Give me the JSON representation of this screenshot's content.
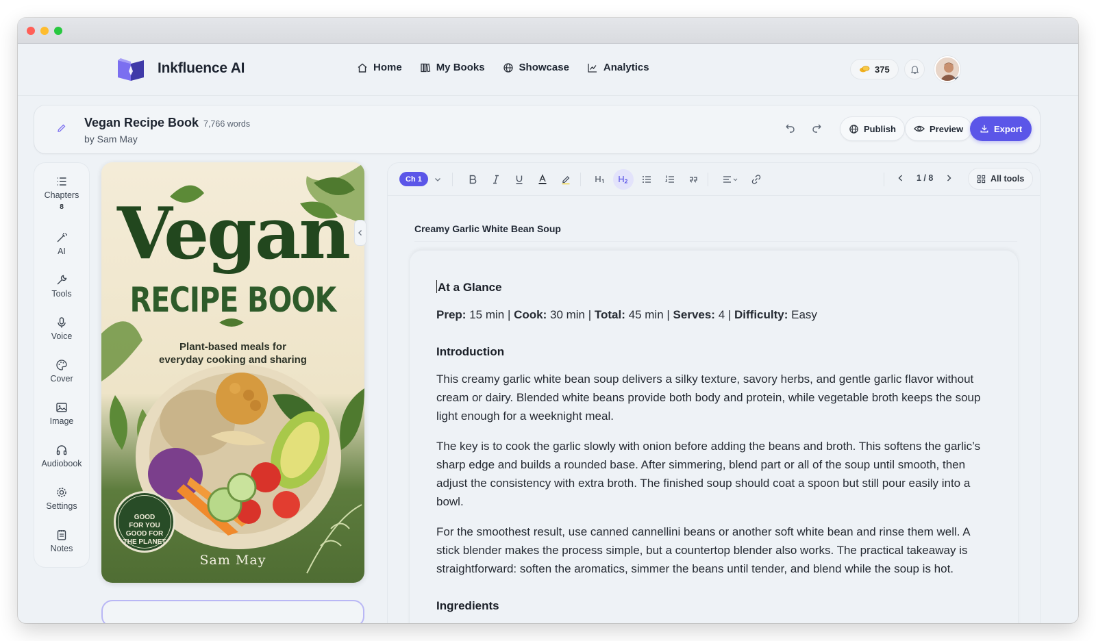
{
  "app": {
    "brand": "Inkfluence AI",
    "nav": [
      {
        "label": "Home",
        "icon": "home-icon"
      },
      {
        "label": "My Books",
        "icon": "books-icon"
      },
      {
        "label": "Showcase",
        "icon": "globe-icon"
      },
      {
        "label": "Analytics",
        "icon": "chart-icon"
      }
    ],
    "credits": "375"
  },
  "book": {
    "title": "Vegan Recipe Book",
    "words": "7,766 words",
    "author": "by Sam May",
    "actions": {
      "publish": "Publish",
      "preview": "Preview",
      "export": "Export"
    }
  },
  "sidebar": {
    "items": [
      {
        "label": "Chapters",
        "count": "8",
        "icon": "list-icon"
      },
      {
        "label": "AI",
        "icon": "magic-wand-icon"
      },
      {
        "label": "Tools",
        "icon": "wrench-icon"
      },
      {
        "label": "Voice",
        "icon": "microphone-icon"
      },
      {
        "label": "Cover",
        "icon": "palette-icon"
      },
      {
        "label": "Image",
        "icon": "image-icon"
      },
      {
        "label": "Audiobook",
        "icon": "headphones-icon"
      },
      {
        "label": "Settings",
        "icon": "gear-icon"
      },
      {
        "label": "Notes",
        "icon": "notepad-icon"
      }
    ]
  },
  "cover": {
    "title": "Vegan",
    "subtitle": "RECIPE BOOK",
    "tagline": "Plant-based meals for everyday cooking and sharing",
    "badge": [
      "GOOD",
      "FOR YOU",
      "GOOD FOR",
      "THE PLANET"
    ],
    "author": "Sam May"
  },
  "editor": {
    "chapter_chip": "Ch 1",
    "pager": "1 / 8",
    "all_tools": "All tools",
    "chapter_title": "Creamy Garlic White Bean Soup",
    "glance_heading": "At a Glance",
    "glance": {
      "prep_label": "Prep:",
      "prep": " 15 min | ",
      "cook_label": "Cook:",
      "cook": " 30 min | ",
      "total_label": "Total:",
      "total": " 45 min | ",
      "serves_label": "Serves:",
      "serves": " 4 | ",
      "difficulty_label": "Difficulty:",
      "difficulty": " Easy"
    },
    "intro_heading": "Introduction",
    "paragraphs": [
      "This creamy garlic white bean soup delivers a silky texture, savory herbs, and gentle garlic flavor without cream or dairy. Blended white beans provide both body and protein, while vegetable broth keeps the soup light enough for a weeknight meal.",
      "The key is to cook the garlic slowly with onion before adding the beans and broth. This softens the garlic’s sharp edge and builds a rounded base. After simmering, blend part or all of the soup until smooth, then adjust the consistency with extra broth. The finished soup should coat a spoon but still pour easily into a bowl.",
      "For the smoothest result, use canned cannellini beans or another soft white bean and rinse them well. A stick blender makes the process simple, but a countertop blender also works. The practical takeaway is straightforward: soften the aromatics, simmer the beans until tender, and blend while the soup is hot."
    ],
    "ingredients_heading": "Ingredients"
  },
  "colors": {
    "accent": "#5b56e8",
    "cover_green": "#22471e"
  }
}
